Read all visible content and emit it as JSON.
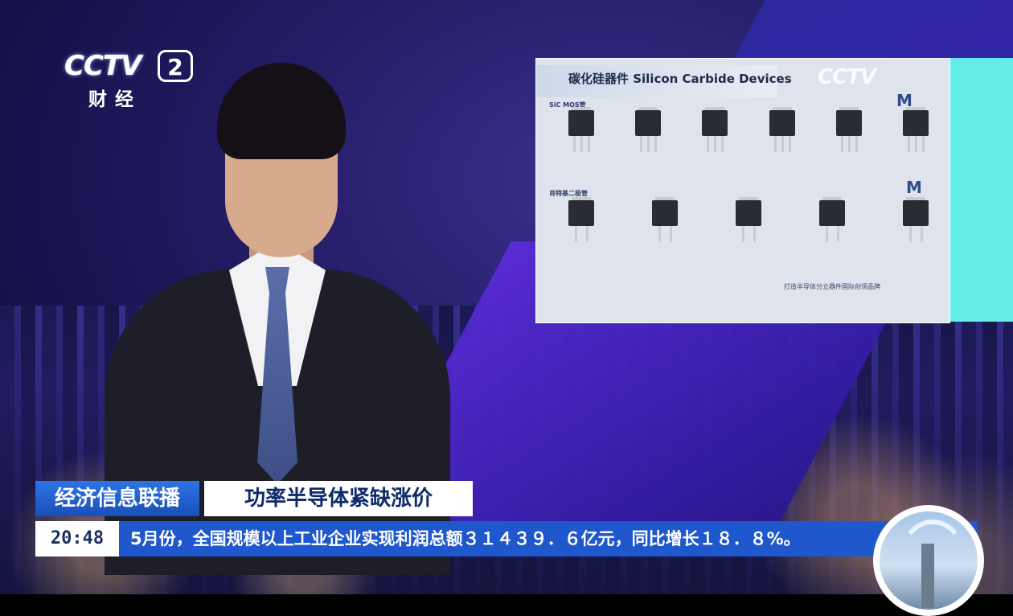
{
  "channel": {
    "logo_text": "CCTV",
    "number": "2",
    "sub_label": "财经"
  },
  "inset": {
    "title": "碳化硅器件 Silicon Carbide Devices",
    "watermark": "CCTV",
    "section_mos": "SiC MOS管",
    "section_diode": "肖特基二极管",
    "slogan": "打造半导体分立器件国际创领品牌"
  },
  "lower_third": {
    "program": "经济信息联播",
    "headline": "功率半导体紧缺涨价"
  },
  "ticker": {
    "time": "20:48",
    "text": "5月份，全国规模以上工业企业实现利润总额３１４３９．６亿元，同比增长１８．８%。"
  },
  "colors": {
    "program_bar": "#1a4fb8",
    "ticker_bar": "#1f57cc",
    "inset_accent": "#63ece8"
  }
}
